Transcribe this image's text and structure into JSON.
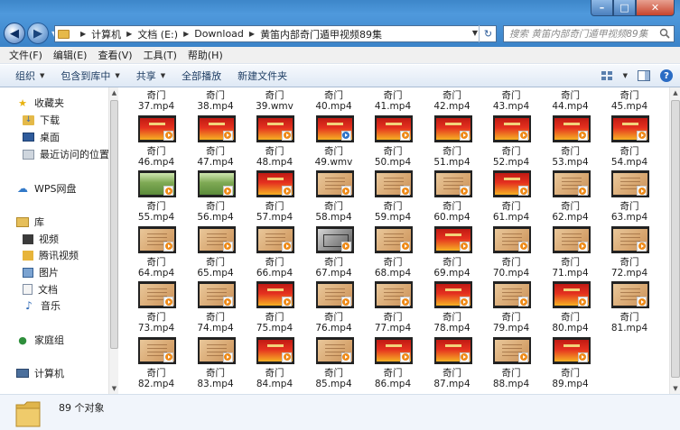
{
  "window": {
    "minimize": "–",
    "maximize": "□",
    "close": "✕"
  },
  "address": {
    "crumbs": [
      "计算机",
      "文档 (E:)",
      "Download",
      "黄笛内部奇门遁甲视频89集"
    ],
    "search_placeholder": "搜索 黄笛内部奇门遁甲视频89集"
  },
  "menu": [
    "文件(F)",
    "编辑(E)",
    "查看(V)",
    "工具(T)",
    "帮助(H)"
  ],
  "toolbar": {
    "organize": "组织",
    "include_library": "包含到库中",
    "share": "共享",
    "play_all": "全部播放",
    "new_folder": "新建文件夹"
  },
  "nav": {
    "favorites": "收藏夹",
    "downloads": "下载",
    "desktop": "桌面",
    "recent": "最近访问的位置",
    "wps": "WPS网盘",
    "libraries": "库",
    "videos": "视频",
    "tencent_video": "腾讯视频",
    "pictures": "图片",
    "documents": "文档",
    "music": "音乐",
    "homegroup": "家庭组",
    "computer": "计算机"
  },
  "files": [
    {
      "name": "奇门",
      "ext": "37.mp4",
      "thumb": "partial"
    },
    {
      "name": "奇门",
      "ext": "38.mp4",
      "thumb": "partial"
    },
    {
      "name": "奇门",
      "ext": "39.wmv",
      "thumb": "partial"
    },
    {
      "name": "奇门",
      "ext": "40.mp4",
      "thumb": "partial"
    },
    {
      "name": "奇门",
      "ext": "41.mp4",
      "thumb": "partial"
    },
    {
      "name": "奇门",
      "ext": "42.mp4",
      "thumb": "partial"
    },
    {
      "name": "奇门",
      "ext": "43.mp4",
      "thumb": "partial"
    },
    {
      "name": "奇门",
      "ext": "44.mp4",
      "thumb": "partial"
    },
    {
      "name": "奇门",
      "ext": "45.mp4",
      "thumb": "partial"
    },
    {
      "name": "奇门",
      "ext": "46.mp4",
      "thumb": "red"
    },
    {
      "name": "奇门",
      "ext": "47.mp4",
      "thumb": "red"
    },
    {
      "name": "奇门",
      "ext": "48.mp4",
      "thumb": "red"
    },
    {
      "name": "奇门",
      "ext": "49.wmv",
      "thumb": "red"
    },
    {
      "name": "奇门",
      "ext": "50.mp4",
      "thumb": "red"
    },
    {
      "name": "奇门",
      "ext": "51.mp4",
      "thumb": "red"
    },
    {
      "name": "奇门",
      "ext": "52.mp4",
      "thumb": "red"
    },
    {
      "name": "奇门",
      "ext": "53.mp4",
      "thumb": "red"
    },
    {
      "name": "奇门",
      "ext": "54.mp4",
      "thumb": "red"
    },
    {
      "name": "奇门",
      "ext": "55.mp4",
      "thumb": "green"
    },
    {
      "name": "奇门",
      "ext": "56.mp4",
      "thumb": "green"
    },
    {
      "name": "奇门",
      "ext": "57.mp4",
      "thumb": "red"
    },
    {
      "name": "奇门",
      "ext": "58.mp4",
      "thumb": "paper"
    },
    {
      "name": "奇门",
      "ext": "59.mp4",
      "thumb": "paper"
    },
    {
      "name": "奇门",
      "ext": "60.mp4",
      "thumb": "paper"
    },
    {
      "name": "奇门",
      "ext": "61.mp4",
      "thumb": "red"
    },
    {
      "name": "奇门",
      "ext": "62.mp4",
      "thumb": "paper"
    },
    {
      "name": "奇门",
      "ext": "63.mp4",
      "thumb": "paper"
    },
    {
      "name": "奇门",
      "ext": "64.mp4",
      "thumb": "paper"
    },
    {
      "name": "奇门",
      "ext": "65.mp4",
      "thumb": "paper"
    },
    {
      "name": "奇门",
      "ext": "66.mp4",
      "thumb": "paper"
    },
    {
      "name": "奇门",
      "ext": "67.mp4",
      "thumb": "map"
    },
    {
      "name": "奇门",
      "ext": "68.mp4",
      "thumb": "paper"
    },
    {
      "name": "奇门",
      "ext": "69.mp4",
      "thumb": "red"
    },
    {
      "name": "奇门",
      "ext": "70.mp4",
      "thumb": "paper"
    },
    {
      "name": "奇门",
      "ext": "71.mp4",
      "thumb": "paper"
    },
    {
      "name": "奇门",
      "ext": "72.mp4",
      "thumb": "paper"
    },
    {
      "name": "奇门",
      "ext": "73.mp4",
      "thumb": "paper"
    },
    {
      "name": "奇门",
      "ext": "74.mp4",
      "thumb": "paper"
    },
    {
      "name": "奇门",
      "ext": "75.mp4",
      "thumb": "red"
    },
    {
      "name": "奇门",
      "ext": "76.mp4",
      "thumb": "paper"
    },
    {
      "name": "奇门",
      "ext": "77.mp4",
      "thumb": "paper"
    },
    {
      "name": "奇门",
      "ext": "78.mp4",
      "thumb": "red"
    },
    {
      "name": "奇门",
      "ext": "79.mp4",
      "thumb": "paper"
    },
    {
      "name": "奇门",
      "ext": "80.mp4",
      "thumb": "red"
    },
    {
      "name": "奇门",
      "ext": "81.mp4",
      "thumb": "paper"
    },
    {
      "name": "奇门",
      "ext": "82.mp4",
      "thumb": "paper"
    },
    {
      "name": "奇门",
      "ext": "83.mp4",
      "thumb": "paper"
    },
    {
      "name": "奇门",
      "ext": "84.mp4",
      "thumb": "red"
    },
    {
      "name": "奇门",
      "ext": "85.mp4",
      "thumb": "paper"
    },
    {
      "name": "奇门",
      "ext": "86.mp4",
      "thumb": "red"
    },
    {
      "name": "奇门",
      "ext": "87.mp4",
      "thumb": "red"
    },
    {
      "name": "奇门",
      "ext": "88.mp4",
      "thumb": "paper"
    },
    {
      "name": "奇门",
      "ext": "89.mp4",
      "thumb": "red"
    }
  ],
  "status": {
    "count_text": "89 个对象"
  },
  "colors": {
    "titlebar": "#3b83c8",
    "accent_orange": "#ee8a18",
    "wmv_blue": "#2d73c8"
  }
}
